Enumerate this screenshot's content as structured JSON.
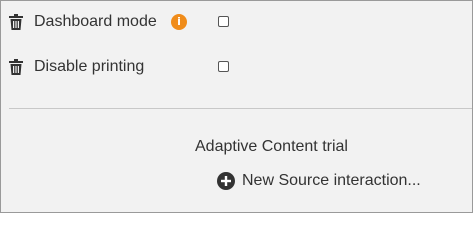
{
  "settings": {
    "rows": [
      {
        "label": "Dashboard mode",
        "has_info": true,
        "checked": false,
        "delete_icon": "trash-icon",
        "info_icon": "info-icon",
        "info_glyph": "i"
      },
      {
        "label": "Disable printing",
        "has_info": false,
        "checked": false,
        "delete_icon": "trash-icon"
      }
    ]
  },
  "adaptive": {
    "section_label": "Adaptive Content trial",
    "add_label": "New Source interaction...",
    "add_icon": "plus-circle-icon"
  },
  "colors": {
    "info_badge": "#f08c1a",
    "background": "#f2f2f2",
    "text": "#333333"
  }
}
